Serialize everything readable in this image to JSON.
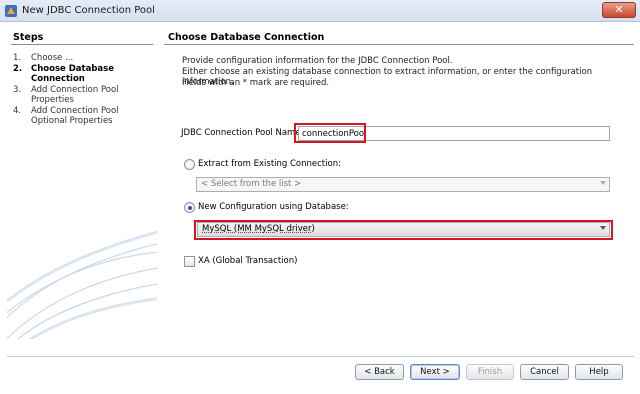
{
  "window": {
    "title": "New JDBC Connection Pool",
    "close_label": "✕"
  },
  "steps": {
    "heading": "Steps",
    "items": [
      {
        "num": "1.",
        "label": "Choose ..."
      },
      {
        "num": "2.",
        "label": "Choose Database Connection"
      },
      {
        "num": "3.",
        "label": "Add Connection Pool Properties"
      },
      {
        "num": "4.",
        "label": "Add Connection Pool Optional Properties"
      }
    ]
  },
  "content": {
    "heading": "Choose Database Connection",
    "desc_line1": "Provide configuration information for the JDBC Connection Pool.",
    "desc_line2": "Either choose an existing database connection to extract information, or enter the configuration information.",
    "desc_line3": "Fields with an * mark are required.",
    "pool_name_label": "JDBC Connection Pool Name:*",
    "pool_name_value": "connectionPool",
    "extract_label": "Extract from Existing Connection:",
    "existing_placeholder": "< Select from the list >",
    "new_config_label": "New Configuration using Database:",
    "database_value": "MySQL (MM MySQL driver)",
    "xa_label": "XA (Global Transaction)"
  },
  "buttons": {
    "back": "< Back",
    "next": "Next >",
    "finish": "Finish",
    "cancel": "Cancel",
    "help": "Help"
  },
  "colors": {
    "highlight": "#d8141c",
    "accent": "#2c5a9e"
  }
}
